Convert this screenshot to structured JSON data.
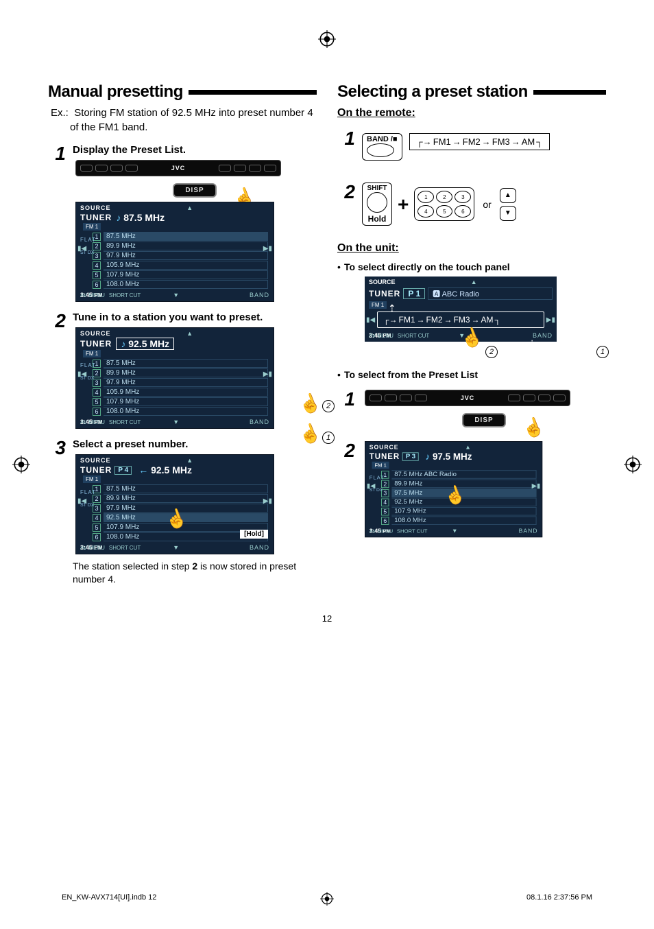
{
  "page_number": "12",
  "footer_left": "EN_KW-AVX714[UI].indb   12",
  "footer_right": "08.1.16   2:37:56 PM",
  "left": {
    "heading": "Manual presetting",
    "intro_prefix": "Ex.:",
    "intro": "Storing FM station of 92.5 MHz into preset number 4 of the FM1 band.",
    "step1": {
      "num": "1",
      "label": "Display the Preset List."
    },
    "step2": {
      "num": "2",
      "label": "Tune in to a station you want to preset."
    },
    "step3": {
      "num": "3",
      "label": "Select a preset number.",
      "desc_a": "The station selected in step ",
      "desc_bold": "2",
      "desc_b": " is now stored in preset number 4."
    },
    "disp": "DISP",
    "hold": "[Hold]"
  },
  "right": {
    "heading": "Selecting a preset station",
    "on_remote": "On the remote:",
    "on_unit": "On the unit:",
    "direct": "To select directly on the touch panel",
    "from_list": "To select from the Preset List",
    "band_label": "BAND /",
    "hold": "Hold",
    "shift": "SHIFT",
    "or": "or",
    "band_chain": [
      "FM1",
      "FM2",
      "FM3",
      "AM"
    ]
  },
  "tuner_common": {
    "source": "SOURCE",
    "tuner": "TUNER",
    "fm1": "FM 1",
    "flat": "FLAT",
    "stdx": "ST  DX",
    "time": "3:45",
    "pm": "PM",
    "avmenu": "AV MENU",
    "shortcut": "SHORT CUT",
    "band": "BAND"
  },
  "screen1": {
    "freq_big": "87.5 MHz",
    "rows": [
      {
        "n": "1",
        "f": "87.5 MHz"
      },
      {
        "n": "2",
        "f": "89.9 MHz"
      },
      {
        "n": "3",
        "f": "97.9 MHz"
      },
      {
        "n": "4",
        "f": "105.9 MHz"
      },
      {
        "n": "5",
        "f": "107.9 MHz"
      },
      {
        "n": "6",
        "f": "108.0 MHz"
      }
    ]
  },
  "screen2": {
    "freq_big": "92.5 MHz",
    "rows": [
      {
        "n": "1",
        "f": "87.5 MHz"
      },
      {
        "n": "2",
        "f": "89.9 MHz"
      },
      {
        "n": "3",
        "f": "97.9 MHz"
      },
      {
        "n": "4",
        "f": "105.9 MHz"
      },
      {
        "n": "5",
        "f": "107.9 MHz"
      },
      {
        "n": "6",
        "f": "108.0 MHz"
      }
    ]
  },
  "screen3": {
    "preset": "P 4",
    "freq_big": "92.5 MHz",
    "rows": [
      {
        "n": "1",
        "f": "87.5 MHz"
      },
      {
        "n": "2",
        "f": "89.9 MHz"
      },
      {
        "n": "3",
        "f": "97.9 MHz"
      },
      {
        "n": "4",
        "f": "92.5 MHz"
      },
      {
        "n": "5",
        "f": "107.9 MHz"
      },
      {
        "n": "6",
        "f": "108.0 MHz"
      }
    ]
  },
  "screen_touch": {
    "preset": "P 1",
    "rname": "ABC Radio"
  },
  "screen_list": {
    "preset": "P 3",
    "freq_big": "97.5 MHz",
    "rows": [
      {
        "n": "1",
        "f": "87.5 MHz  ABC Radio"
      },
      {
        "n": "2",
        "f": "89.9 MHz"
      },
      {
        "n": "3",
        "f": "97.5 MHz"
      },
      {
        "n": "4",
        "f": "92.5 MHz"
      },
      {
        "n": "5",
        "f": "107.9 MHz"
      },
      {
        "n": "6",
        "f": "108.0 MHz"
      }
    ]
  },
  "call1": "1",
  "call2": "2",
  "jvc": "JVC"
}
